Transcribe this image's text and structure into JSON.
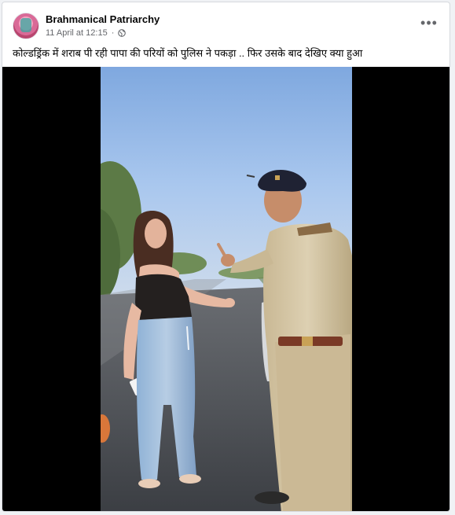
{
  "post": {
    "page_name": "Brahmanical Patriarchy",
    "date": "11 April at 12:15",
    "dot": "·",
    "caption": "कोल्डड्रिंक में शराब पी रही पापा की परियों को पुलिस ने पकड़ा .. फिर उसके बाद देखिए क्या हुआ",
    "more_icon": "more-horizontal-icon",
    "audience_icon": "globe-icon"
  },
  "colors": {
    "accent": "#1877f2",
    "text_primary": "#050505",
    "text_secondary": "#65676b",
    "sky": "#8fb8e8",
    "road": "#4a4d52"
  }
}
